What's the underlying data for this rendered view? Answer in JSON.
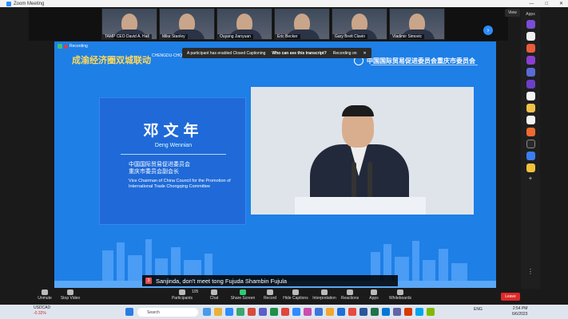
{
  "window": {
    "title": "Zoom Meeting",
    "controls": [
      "—",
      "□",
      "✕"
    ]
  },
  "gallery": {
    "participants": [
      {
        "name": "TAMP CEO David A. Hall"
      },
      {
        "name": "Mike Stanley"
      },
      {
        "name": "Ouyang Jianyuan"
      },
      {
        "name": "Eric Becker"
      },
      {
        "name": "Gary Brett Clavin"
      },
      {
        "name": "Vladimir Simovic"
      }
    ],
    "next_arrow": "›",
    "view_label": "View"
  },
  "apps_sidebar": {
    "label": "Apps",
    "add": "+",
    "more": "⋮"
  },
  "stage": {
    "recording_label": "Recording",
    "event_logo_cn": "成渝经济圈双城联动",
    "event_logo_en": "CHENGDU-CHONGQING ECONOMIC CIRCLE",
    "org_name_cn": "中国国际贸易促进委员会重庆市委员会",
    "cc_notice": "A participant has enabled Closed Captioning",
    "cc_question": "Who can see this transcript?",
    "cc_status": "Recording on",
    "cc_close": "✕",
    "speaker_name_cn": "邓文年",
    "speaker_name_en": "Deng Wennian",
    "speaker_title_cn_1": "中国国际贸易促进委员会",
    "speaker_title_cn_2": "重庆市委员会副会长",
    "speaker_title_en": "Vice Chairman of China Council for the Promotion of International Trade Chongqing Committee",
    "caption_badge": "3",
    "caption_text": "Sanjinda, don't meet tong Fujuda Shambin Fujula"
  },
  "controls": {
    "unmute": "Unmute",
    "stop_video": "Stop Video",
    "participants": "Participants",
    "participants_count": "105",
    "chat": "Chat",
    "share_screen": "Share Screen",
    "record": "Record",
    "hide_captions": "Hide Captions",
    "interpretation": "Interpretation",
    "reactions": "Reactions",
    "apps": "Apps",
    "whiteboards": "Whiteboards",
    "leave": "Leave"
  },
  "taskbar": {
    "ticker": "USDCAD",
    "ticker_change": "-0.32%",
    "search_placeholder": "Search",
    "language": "ENG",
    "time": "2:54 PM",
    "date": "6/6/2023"
  }
}
